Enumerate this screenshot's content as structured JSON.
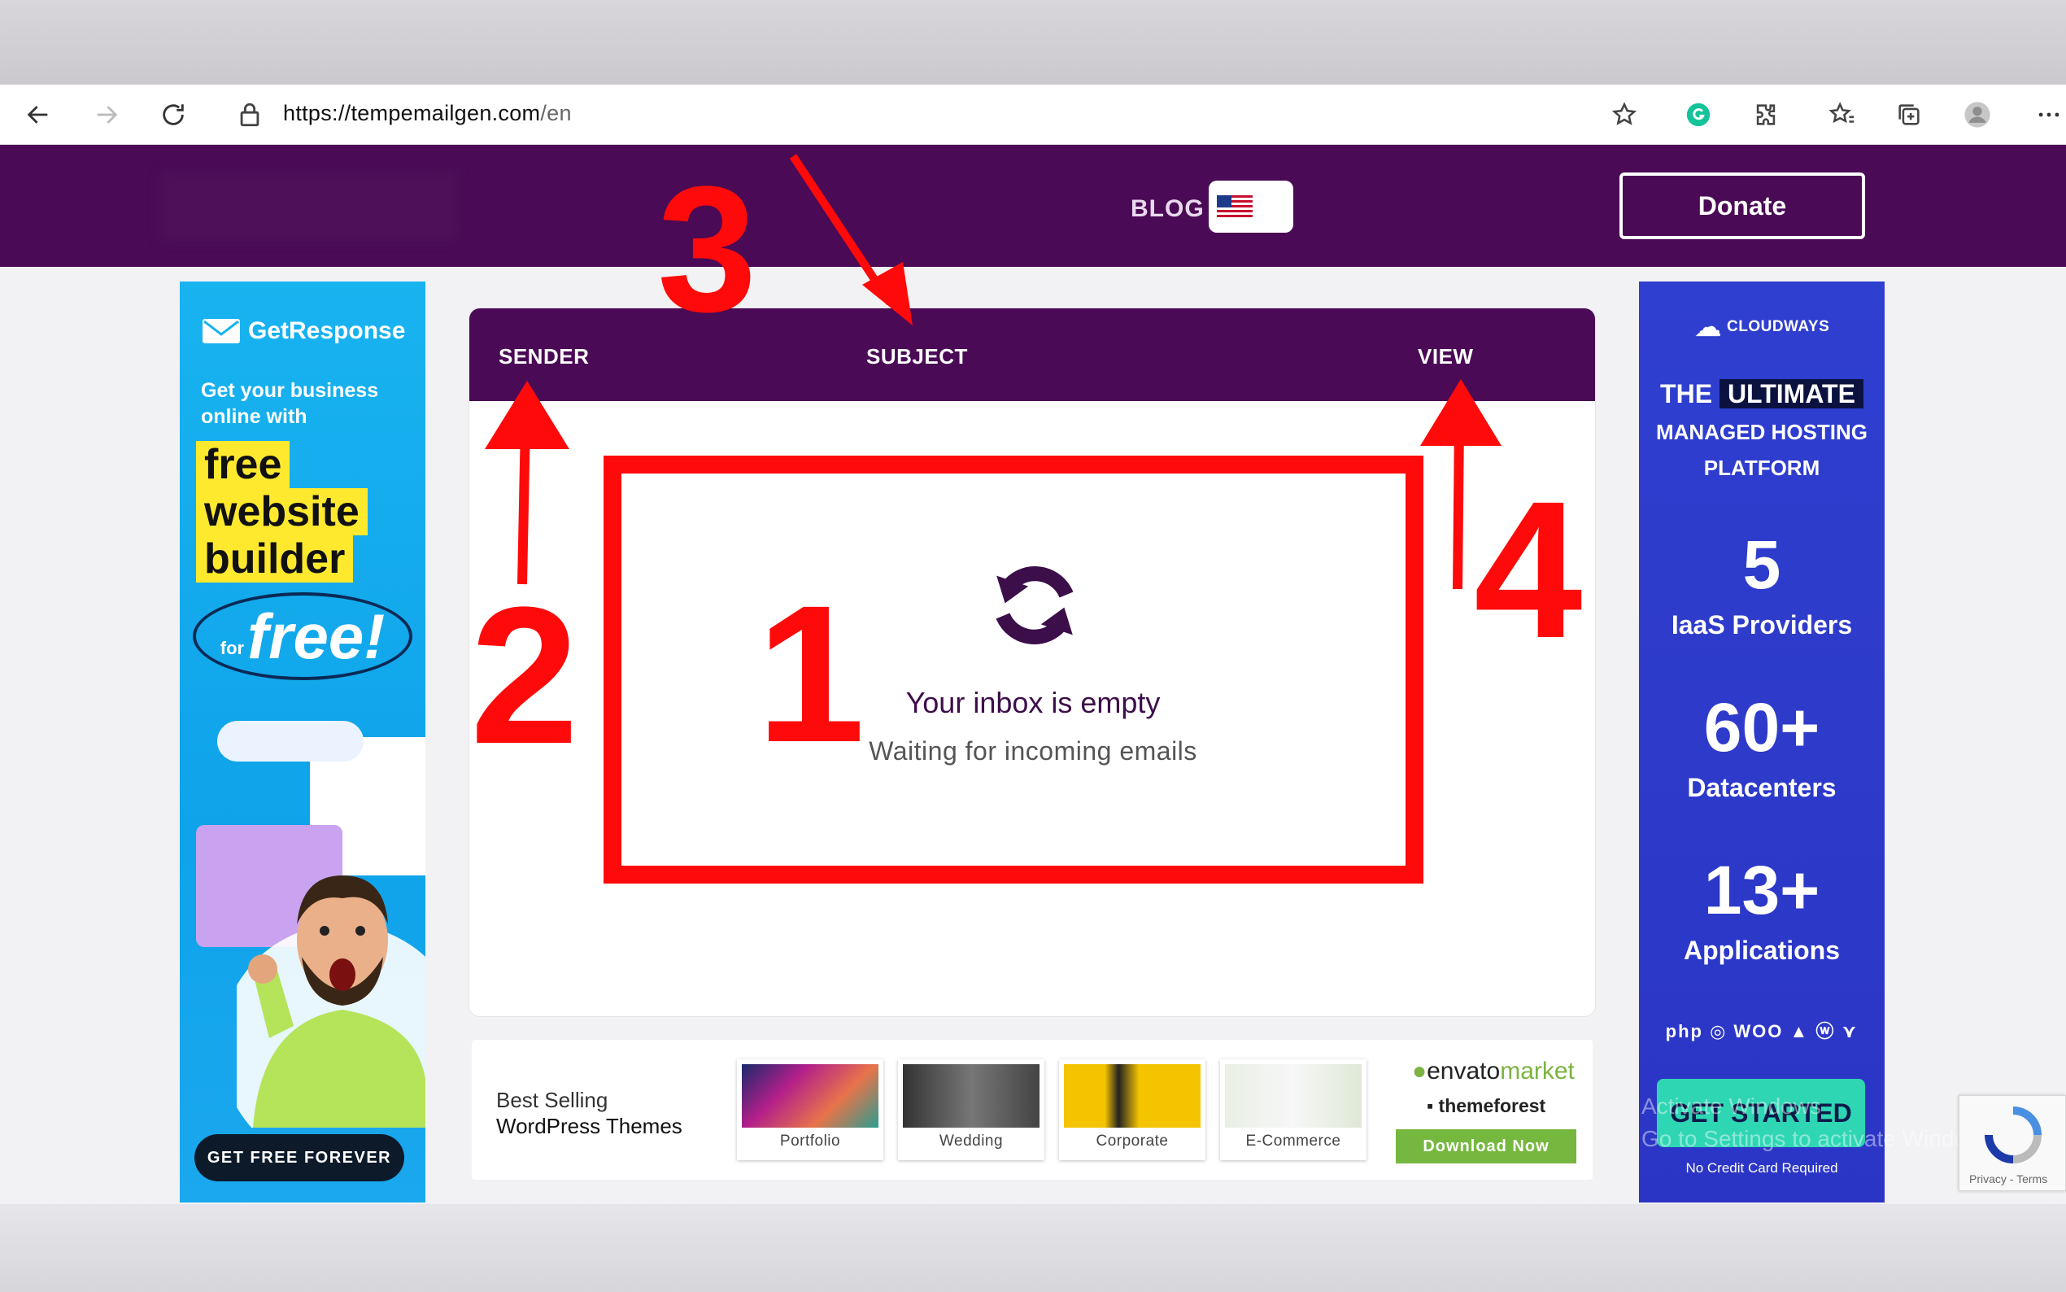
{
  "browser": {
    "url_domain": "https://tempemailgen.com",
    "url_path": "/en"
  },
  "header": {
    "blog_label": "BLOG",
    "donate_label": "Donate"
  },
  "inbox": {
    "columns": [
      "SENDER",
      "SUBJECT",
      "VIEW"
    ],
    "empty_title": "Your inbox is empty",
    "empty_subtitle": "Waiting for incoming emails"
  },
  "annotations": {
    "n1": "1",
    "n2": "2",
    "n3": "3",
    "n4": "4",
    "color": "#ff0a0a"
  },
  "ad_left": {
    "brand": "GetResponse",
    "tagline": "Get your business online with",
    "highlight_1": "free",
    "highlight_2": "website",
    "highlight_3": "builder",
    "free_prefix": "for",
    "free_word": "free!",
    "cta": "GET FREE FOREVER"
  },
  "envato": {
    "title_line1": "Best Selling",
    "title_line2": "WordPress Themes",
    "themes": [
      "Portfolio",
      "Wedding",
      "Corporate",
      "E-Commerce"
    ],
    "logo_main": "envato",
    "logo_accent": "market",
    "themeforest": "themeforest",
    "download": "Download Now"
  },
  "ad_right": {
    "brand": "CLOUDWAYS",
    "line_the": "THE",
    "line_ultimate": "ULTIMATE",
    "line_managed": "MANAGED HOSTING",
    "line_platform": "PLATFORM",
    "stat1_value": "5",
    "stat1_label": "IaaS Providers",
    "stat2_value": "60+",
    "stat2_label": "Datacenters",
    "stat3_value": "13+",
    "stat3_label": "Applications",
    "stack": "php ◎ WOO ▲ ⓦ ⋎",
    "cta": "GET STARTED",
    "no_cc": "No Credit Card Required"
  },
  "watermark": {
    "line1": "Activate Windows",
    "line2": "Go to Settings to activate Windows."
  },
  "recaptcha": {
    "text": "Privacy - Terms"
  },
  "colors": {
    "brand_purple": "#4a0a55",
    "cloudways_blue": "#2f3fcf",
    "getresponse_blue": "#19b3f0",
    "annotation_red": "#ff0a0a"
  }
}
